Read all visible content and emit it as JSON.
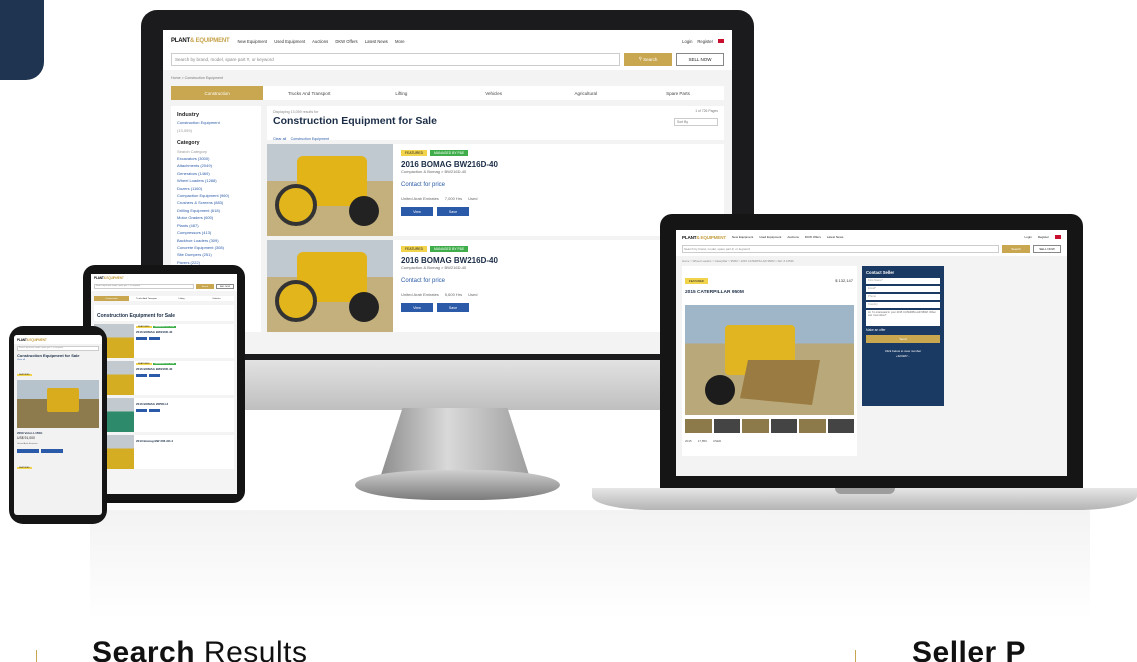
{
  "site": {
    "logo_main": "PLANT",
    "logo_accent": "& EQUIPMENT",
    "nav": [
      "New Equipment",
      "Used Equipment",
      "Auctions",
      "DKW Offers",
      "Latest News",
      "More"
    ],
    "login": "Login",
    "register": "Register",
    "search_placeholder": "Search by brand, model, spare part #, or keyword",
    "search_btn": "Search",
    "sell_btn": "SELL NOW"
  },
  "monitor": {
    "breadcrumb": "Home > Construction Equipment",
    "tabs": [
      "Construction",
      "Trucks And Transport",
      "Lifting",
      "Vehicles",
      "Agricultural",
      "Spare Parts"
    ],
    "sidebar": {
      "industry_label": "Industry",
      "industry_value": "Construction Equipment",
      "industry_count": "(13,059)",
      "category_label": "Category",
      "category_search": "Search Category",
      "categories": [
        "Excavators (3000)",
        "Attachments (2049)",
        "Generators (1469)",
        "Wheel Loaders (1288)",
        "Dozers (1160)",
        "Compaction Equipment (960)",
        "Crushers & Screens (883)",
        "Drilling Equipment (618)",
        "Motor Graders (600)",
        "Plants (487)",
        "Compressors (413)",
        "Backhoe Loaders (309)",
        "Concrete Equipment (308)",
        "Site Dumpers (251)",
        "Pavers (222)"
      ]
    },
    "results_count": "Displaying 13,059 results for",
    "heading": "Construction Equipment for Sale",
    "clear_all": "Clear all",
    "filter_tag": "Construction Equipment",
    "page_info": "1 of 726 Pages",
    "sort_by": "Sort By",
    "listings": [
      {
        "badge_featured": "FEATURED",
        "badge_managed": "MANAGED BY P&E",
        "title": "2016 BOMAG BW216D-40",
        "subtitle": "Compaction & Bomag > BW216D-40",
        "price": "Contact for price",
        "location": "United Arab Emirates",
        "hours": "7,000 Hrs",
        "condition": "Used",
        "view": "View",
        "save": "Save"
      },
      {
        "badge_featured": "FEATURED",
        "badge_managed": "MANAGED BY P&E",
        "title": "2016 BOMAG BW216D-40",
        "subtitle": "Compaction & Bomag > BW216D-40",
        "price": "Contact for price",
        "location": "United Arab Emirates",
        "hours": "5,600 Hrs",
        "condition": "Used",
        "view": "View",
        "save": "Save"
      }
    ]
  },
  "laptop": {
    "breadcrumb": "Home > Wheel Loaders > Caterpillar > 950M > 2015 CATERPILLAR 950M > Ref. # 14536",
    "badge": "FEATURED",
    "title": "2015 CATERPILLAR 950M",
    "price": "$ 132,147",
    "contact_title": "Contact Seller",
    "fields": [
      "First Name*",
      "Email*",
      "Phone",
      "Country"
    ],
    "message": "Hi, I'm interested in your 2015 CATERPILLAR 950M. When can I test drive?",
    "offer_label": "Make an offer",
    "send": "Send",
    "reveal": "Click below to view number",
    "phone": "+323187...",
    "specs": [
      "2015",
      "17,856",
      "USED"
    ]
  },
  "tablet": {
    "heading": "Construction Equipment for Sale",
    "listings": [
      "2016 BOMAG BW216D-40",
      "2016 BOMAG BW216D-40",
      "2016 BOMAG 20PDH-2",
      "2013 Bomag BW 206 AD-4"
    ]
  },
  "phone": {
    "title": "Construction Equipment for Sale",
    "sub": "Clear all",
    "badge": "FEATURED",
    "item": "2009 Volvo L150G",
    "price": "US$ 91,000",
    "location": "United Arab Emirates"
  },
  "bottom": {
    "left_bold": "Search",
    "left_rest": " Results",
    "right_bold": "Seller P"
  },
  "colors": {
    "accent": "#c9a750",
    "brand": "#1b2d46",
    "link": "#2a5aa8",
    "managed": "#3fae4a"
  }
}
